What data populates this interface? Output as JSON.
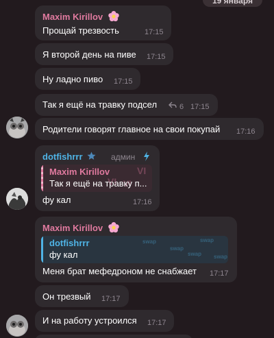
{
  "date_label": "19 января",
  "messages": [
    {
      "sender": "Maxim Kirillov",
      "text": "Прощай трезвость",
      "time": "17:15"
    },
    {
      "text": "Я второй день на пиве",
      "time": "17:15"
    },
    {
      "text": "Ну ладно пиво",
      "time": "17:15"
    },
    {
      "text": "Так я ещё на травку подсел",
      "time": "17:15",
      "reply_count": "6"
    },
    {
      "text": "Родители говорят главное на свои покупай",
      "time": "17:16"
    },
    {
      "sender": "dotfishrrr",
      "sender_role": "админ",
      "reply_to_name": "Maxim Kirillov",
      "reply_to_text": "Так я ещё на травку п...",
      "reply_bg_text": "VI",
      "text": "фу кал",
      "time": "17:16"
    },
    {
      "sender": "Maxim Kirillov",
      "reply_to_name": "dotfishrrr",
      "reply_to_text": "фу кал",
      "reply_bg_text": "swap",
      "text": "Меня брат мефедроном не снабжает",
      "time": "17:17"
    },
    {
      "text": "Он трезвый",
      "time": "17:17"
    },
    {
      "text": "И на работу устроился",
      "time": "17:17"
    }
  ],
  "colors": {
    "background": "#221a1e",
    "bubble": "#2f2a2e",
    "maxim_name": "#e07a9f",
    "dotfish_name": "#4fb4e6"
  },
  "icons": {
    "maxim_badge": "flower-emoji-icon",
    "dotfish_badge": "star-icon",
    "admin_badge": "lightning-icon",
    "reply_count": "reply-arrow-icon"
  }
}
